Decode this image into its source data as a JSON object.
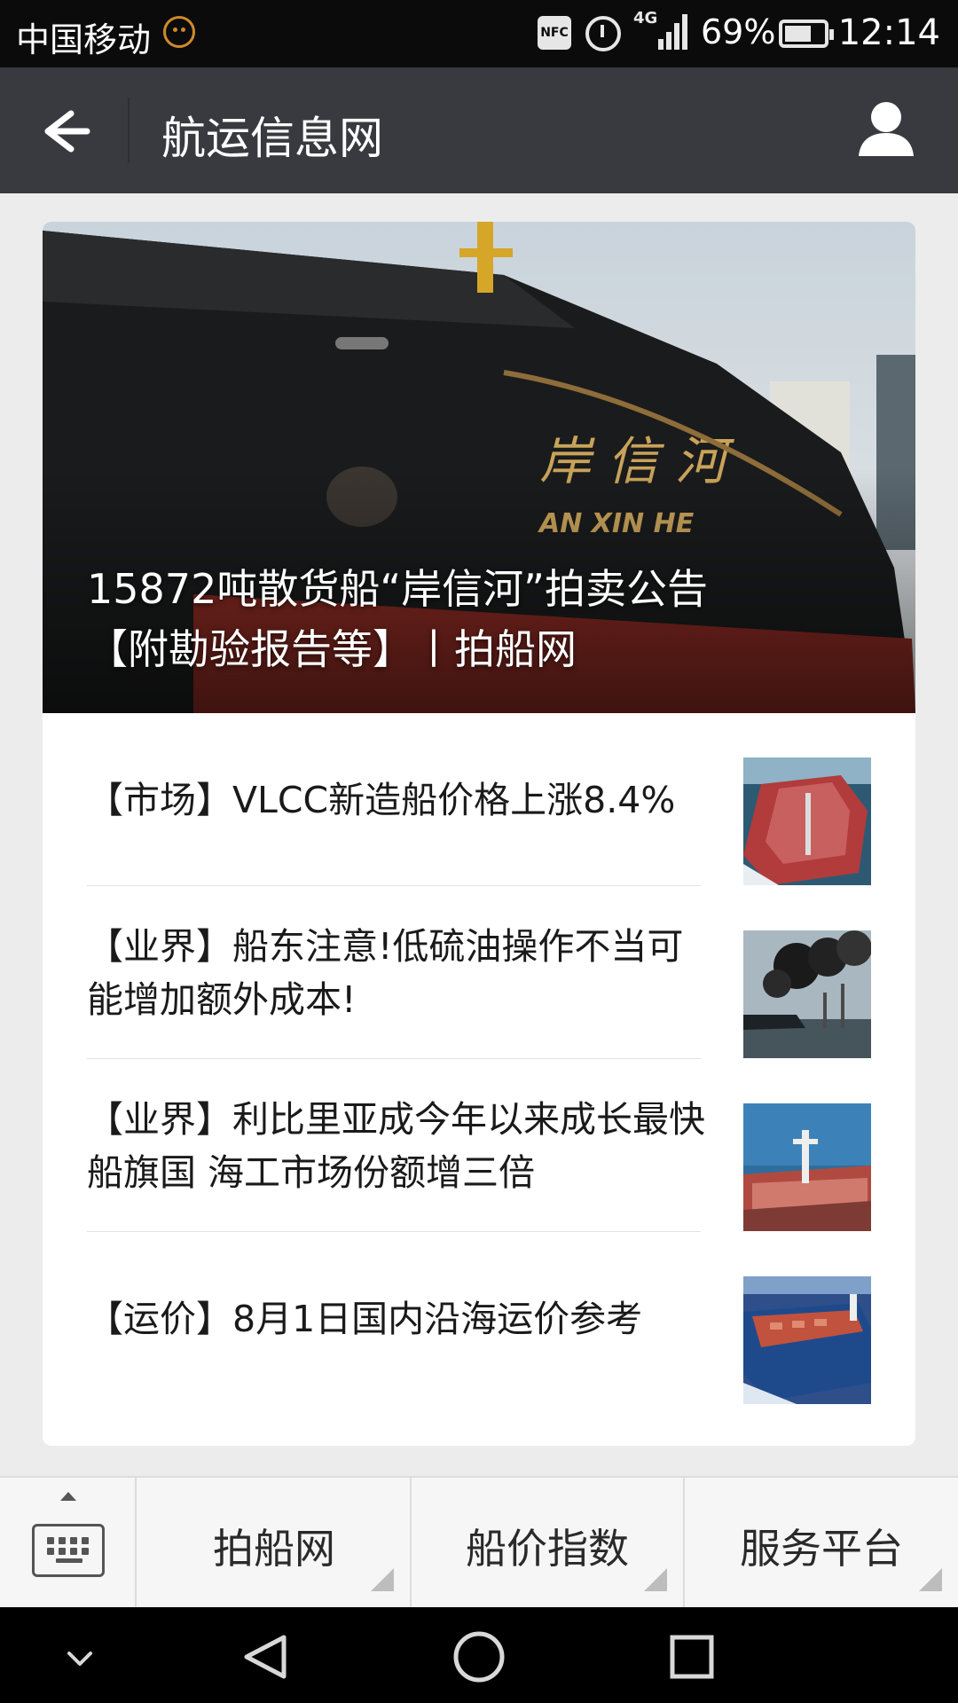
{
  "status_bar": {
    "carrier": "中国移动",
    "nfc": "NFC",
    "network": "4G",
    "battery_percent": "69%",
    "battery_level": 0.69,
    "time": "12:14"
  },
  "header": {
    "title": "航运信息网"
  },
  "hero": {
    "title": "15872吨散货船“岸信河”拍卖公告【附勘验报告等】丨拍船网"
  },
  "news": [
    {
      "title": "【市场】VLCC新造船价格上涨8.4%",
      "thumb": "tanker-ship-image"
    },
    {
      "title": "【业界】船东注意!低硫油操作不当可能增加额外成本!",
      "thumb": "smoke-ship-image"
    },
    {
      "title": "【业界】利比里亚成今年以来成长最快船旗国 海工市场份额增三倍",
      "thumb": "ship-deck-image"
    },
    {
      "title": "【运价】8月1日国内沿海运价参考",
      "thumb": "bulk-carrier-image"
    }
  ],
  "bottom_menu": {
    "tabs": [
      {
        "label": "拍船网"
      },
      {
        "label": "船价指数"
      },
      {
        "label": "服务平台"
      }
    ]
  }
}
